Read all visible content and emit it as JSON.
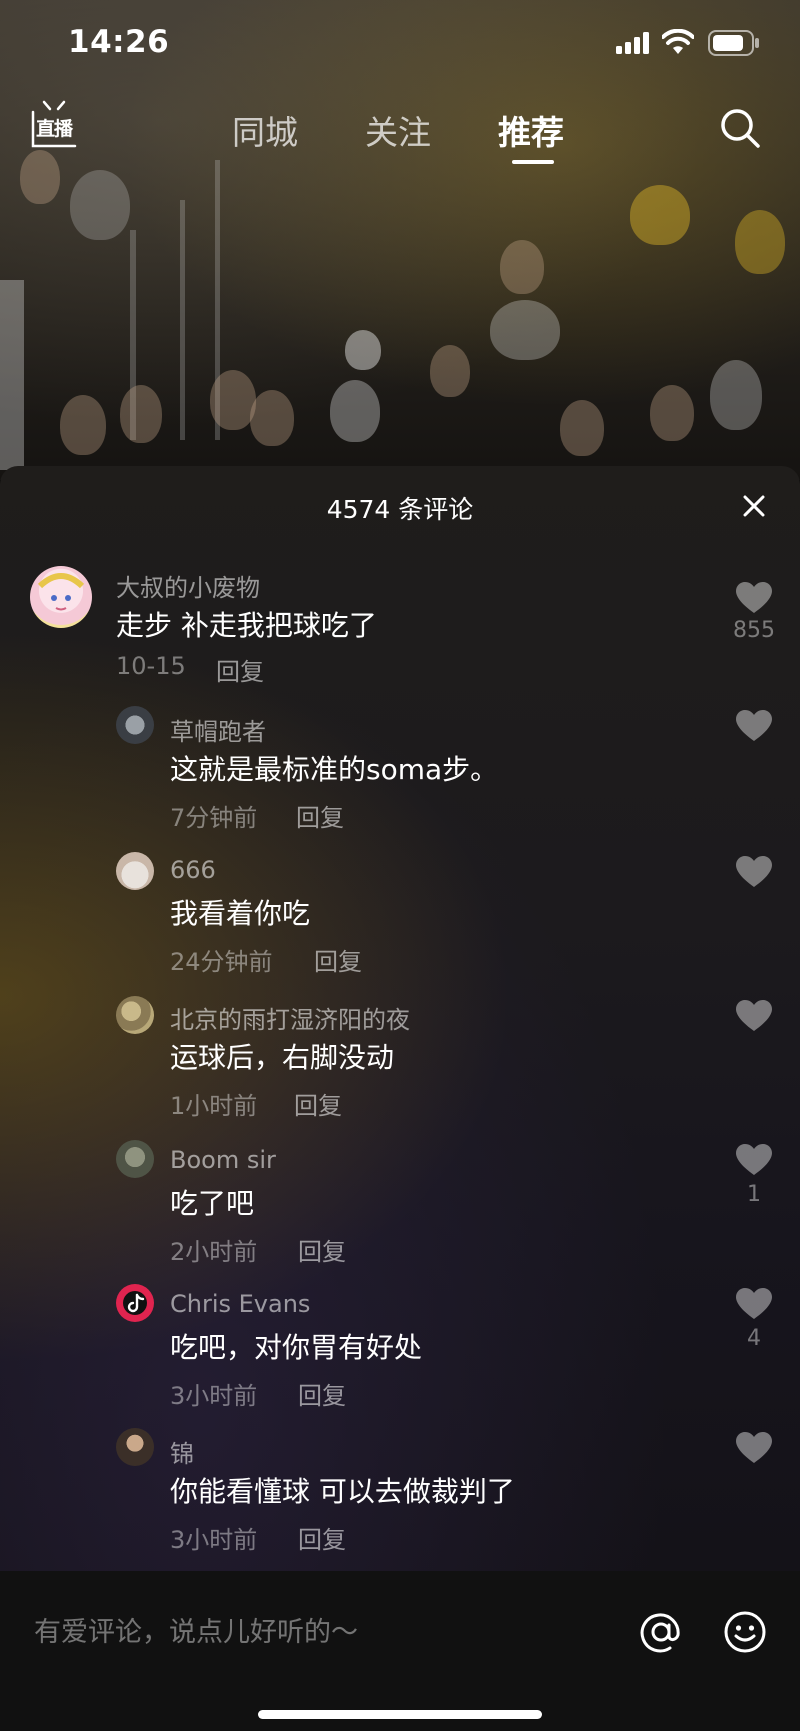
{
  "status_bar": {
    "time": "14:26"
  },
  "top_nav": {
    "live_label": "直播",
    "tabs": [
      {
        "label": "同城",
        "active": false
      },
      {
        "label": "关注",
        "active": false
      },
      {
        "label": "推荐",
        "active": true
      }
    ]
  },
  "comments_panel": {
    "title": "4574 条评论",
    "comments": [
      {
        "author": "大叔的小废物",
        "text": "走步 补走我把球吃了",
        "time": "10-15",
        "reply_label": "回复",
        "likes": "855"
      },
      {
        "author": "草帽跑者",
        "text": "这就是最标准的soma步。",
        "time": "7分钟前",
        "reply_label": "回复",
        "likes": ""
      },
      {
        "author": "666",
        "text": "我看着你吃",
        "time": "24分钟前",
        "reply_label": "回复",
        "likes": ""
      },
      {
        "author": "北京的雨打湿济阳的夜",
        "text": "运球后，右脚没动",
        "time": "1小时前",
        "reply_label": "回复",
        "likes": ""
      },
      {
        "author": "Boom sir",
        "text": "吃了吧",
        "time": "2小时前",
        "reply_label": "回复",
        "likes": "1"
      },
      {
        "author": "Chris Evans",
        "text": "吃吧，对你胃有好处",
        "time": "3小时前",
        "reply_label": "回复",
        "likes": "4"
      },
      {
        "author": "锦",
        "text": "你能看懂球 可以去做裁判了",
        "time": "3小时前",
        "reply_label": "回复",
        "likes": ""
      }
    ]
  },
  "input_bar": {
    "placeholder": "有爱评论，说点儿好听的～"
  },
  "colors": {
    "text_primary": "#ffffff",
    "text_secondary": "#8c8c8c",
    "sheet_bg": "#1c1a1d"
  }
}
